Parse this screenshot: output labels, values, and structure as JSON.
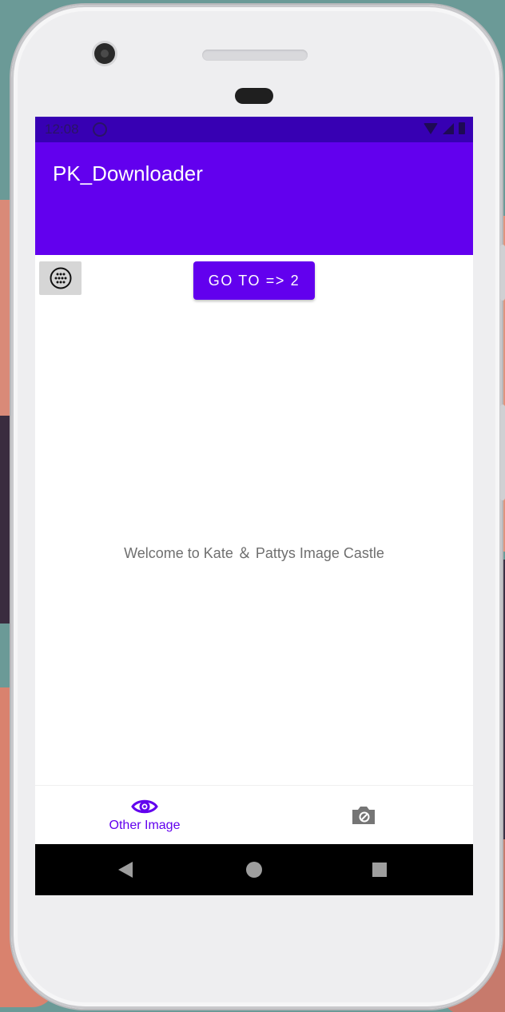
{
  "status_bar": {
    "time": "12:08"
  },
  "app_bar": {
    "title": "PK_Downloader"
  },
  "toolbar": {
    "go_button_label": "GO TO => 2"
  },
  "content": {
    "welcome_text": "Welcome to Kate ＆ Pattys Image Castle"
  },
  "bottom_nav": {
    "items": [
      {
        "label": "Other Image",
        "icon": "eye-icon",
        "selected": true
      },
      {
        "label": "",
        "icon": "camera-icon",
        "selected": false
      }
    ]
  },
  "colors": {
    "primary": "#6200ee",
    "primary_dark": "#3700b3",
    "text_secondary": "#6f6f6f",
    "nav_inactive": "#757575"
  }
}
